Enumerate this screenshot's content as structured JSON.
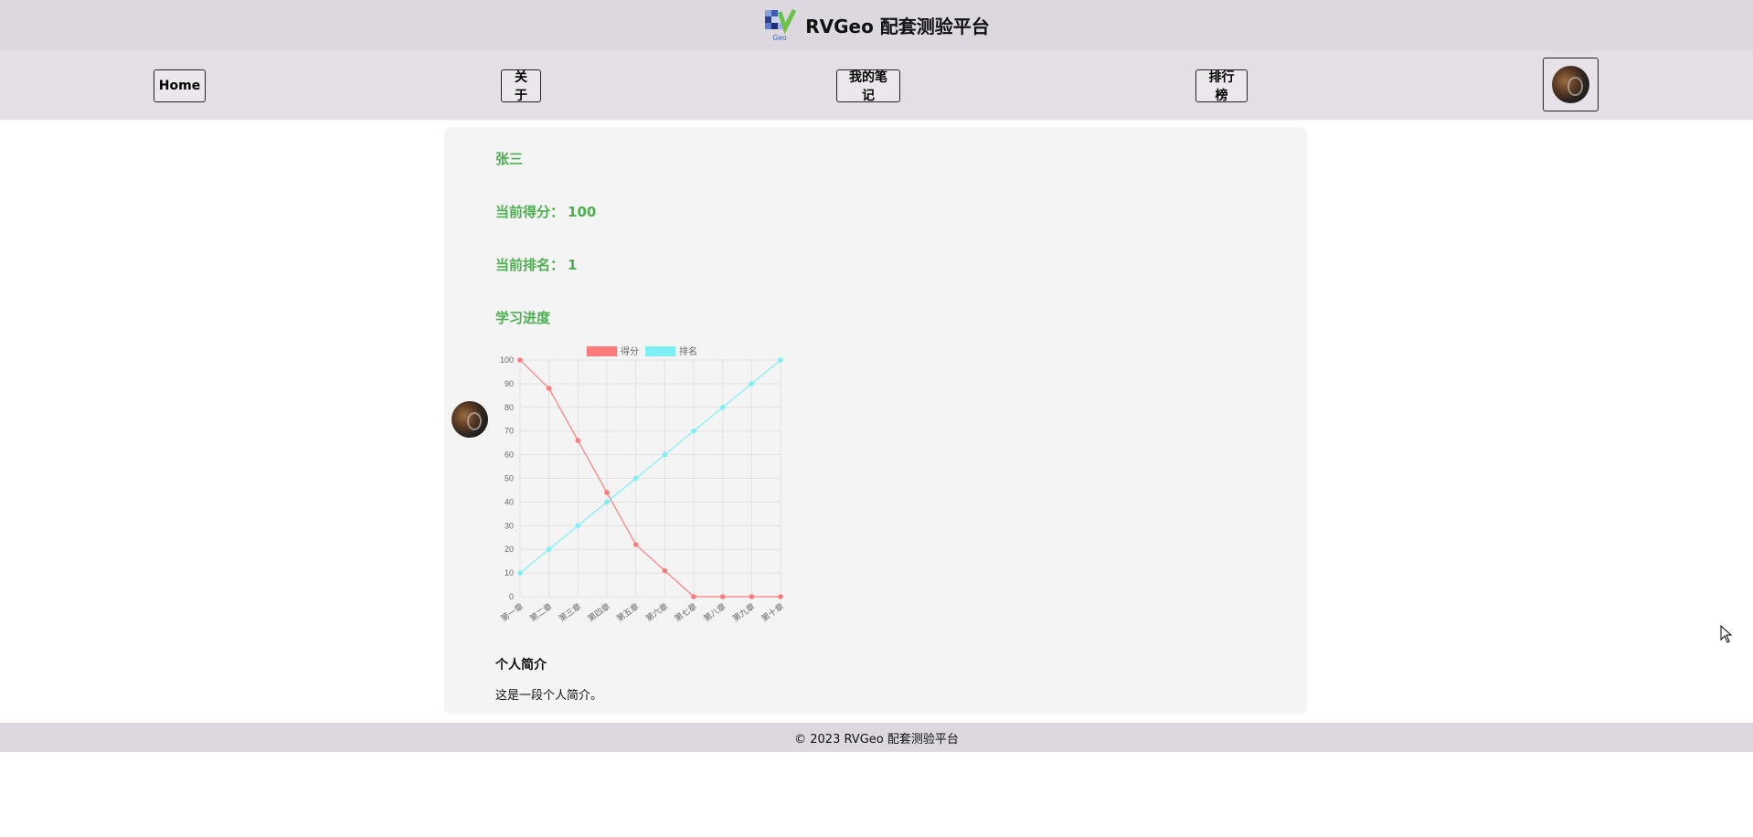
{
  "header": {
    "logo_text": "Geo",
    "title": "RVGeo 配套测验平台"
  },
  "nav": {
    "home": "Home",
    "about": "关于",
    "notes": "我的笔记",
    "ranking": "排行榜"
  },
  "profile": {
    "name": "张三",
    "score_label": "当前得分：",
    "score_value": "100",
    "rank_label": "当前排名：",
    "rank_value": "1",
    "progress_label": "学习进度",
    "intro_heading": "个人简介",
    "intro_text": "这是一段个人简介。"
  },
  "footer": {
    "text": "© 2023 RVGeo 配套测验平台"
  },
  "colors": {
    "header_bg": "#ddd8df",
    "nav_bg": "#e3dfe4",
    "accent_green": "#4caf50",
    "series_score": "#ff7b7b",
    "series_rank": "#7ef0f5"
  },
  "chart_data": {
    "type": "line",
    "categories": [
      "第一章",
      "第二章",
      "第三章",
      "第四章",
      "第五章",
      "第六章",
      "第七章",
      "第八章",
      "第九章",
      "第十章"
    ],
    "series": [
      {
        "name": "得分",
        "color": "#ff7b7b",
        "values": [
          100,
          88,
          66,
          44,
          22,
          11,
          0,
          0,
          0,
          0
        ]
      },
      {
        "name": "排名",
        "color": "#7ef0f5",
        "values": [
          10,
          20,
          30,
          40,
          50,
          60,
          70,
          80,
          90,
          100
        ]
      }
    ],
    "ylim": [
      0,
      100
    ],
    "yticks": [
      0,
      10,
      20,
      30,
      40,
      50,
      60,
      70,
      80,
      90,
      100
    ],
    "grid": true,
    "legend": "top-center"
  }
}
